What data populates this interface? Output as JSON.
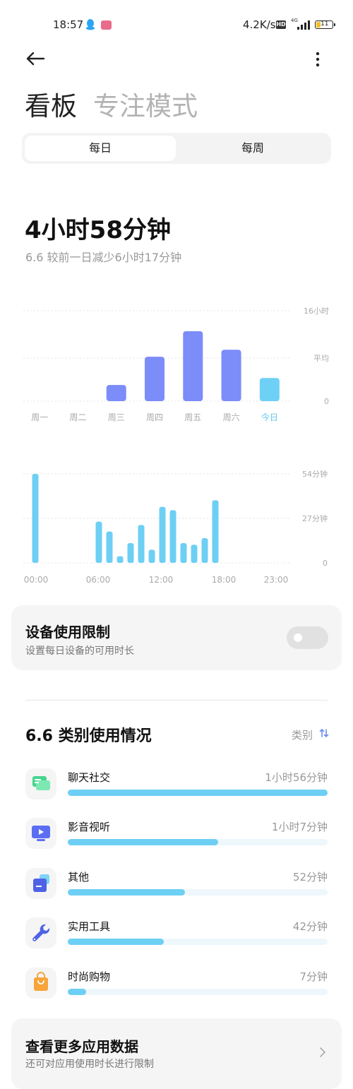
{
  "status_bar": {
    "time": "18:57",
    "net_speed": "4.2K/s",
    "hd": "HD",
    "network": "4G",
    "battery": "11"
  },
  "tabs": {
    "dashboard": "看板",
    "focus": "专注模式"
  },
  "segment": {
    "daily": "每日",
    "weekly": "每周"
  },
  "summary": {
    "total": "4小时58分钟",
    "compare": "6.6  较前一日减少6小时17分钟"
  },
  "weekly_chart": {
    "type": "bar",
    "categories": [
      "周一",
      "周二",
      "周三",
      "周四",
      "周五",
      "周六",
      "今日"
    ],
    "values_minutes": [
      0,
      0,
      120,
      330,
      520,
      382,
      172
    ],
    "y_max_minutes": 672,
    "avg_minutes": 320,
    "y_labels": [
      "16小时",
      "平均",
      "0"
    ],
    "colors": {
      "past": "#7c8cf8",
      "today": "#6fd0f6",
      "today_label": "#5ec8ef"
    }
  },
  "hourly_chart": {
    "type": "bar",
    "x": [
      0,
      6,
      7,
      8,
      9,
      10,
      11,
      12,
      13,
      14,
      15,
      16,
      17
    ],
    "values_minutes": [
      54,
      25,
      19,
      4,
      12,
      23,
      8,
      34,
      32,
      12,
      11,
      15,
      38
    ],
    "y_max_minutes": 54,
    "y_labels": [
      "54分钟",
      "27分钟",
      "0"
    ],
    "x_labels": [
      "00:00",
      "06:00",
      "12:00",
      "18:00",
      "23:00"
    ],
    "color": "#6ecff4"
  },
  "device_limit": {
    "title": "设备使用限制",
    "subtitle": "设置每日设备的可用时长",
    "enabled": false
  },
  "category": {
    "title": "6.6 类别使用情况",
    "sort_label": "类别",
    "items": [
      {
        "name": "聊天社交",
        "time": "1小时56分钟",
        "fraction": 1.0,
        "icon": "chat-icon"
      },
      {
        "name": "影音视听",
        "time": "1小时7分钟",
        "fraction": 0.58,
        "icon": "video-icon"
      },
      {
        "name": "其他",
        "time": "52分钟",
        "fraction": 0.45,
        "icon": "other-icon"
      },
      {
        "name": "实用工具",
        "time": "42分钟",
        "fraction": 0.37,
        "icon": "wrench-icon"
      },
      {
        "name": "时尚购物",
        "time": "7分钟",
        "fraction": 0.07,
        "icon": "shopping-bag-icon"
      }
    ]
  },
  "more": {
    "title": "查看更多应用数据",
    "subtitle": "还可对应用使用时长进行限制"
  }
}
